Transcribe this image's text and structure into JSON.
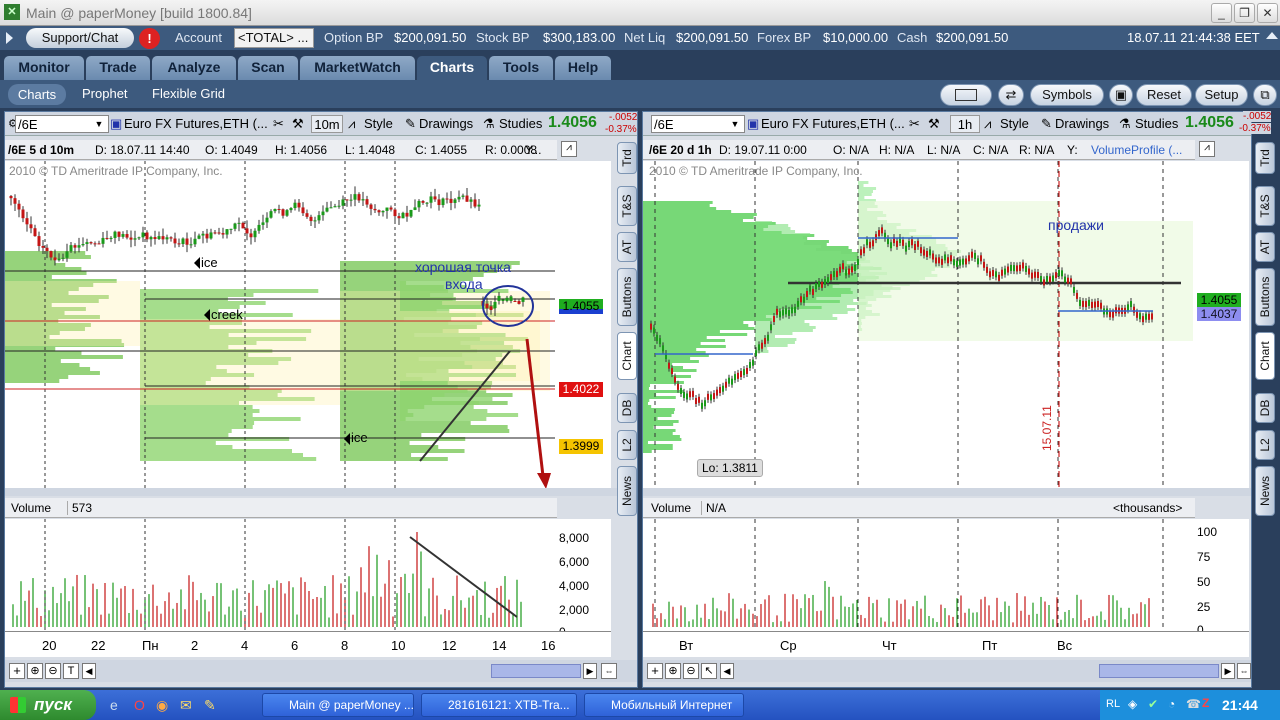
{
  "window": {
    "title": "Main @ paperMoney [build 1800.84]"
  },
  "account": {
    "support": "Support/Chat",
    "account_label": "Account",
    "account_value": "<TOTAL> ...",
    "option_bp_label": "Option BP",
    "option_bp": "$200,091.50",
    "stock_bp_label": "Stock BP",
    "stock_bp": "$300,183.00",
    "net_liq_label": "Net Liq",
    "net_liq": "$200,091.50",
    "forex_bp_label": "Forex BP",
    "forex_bp": "$10,000.00",
    "cash_label": "Cash",
    "cash": "$200,091.50",
    "datetime": "18.07.11 21:44:38 EET"
  },
  "main_tabs": [
    "Monitor",
    "Trade",
    "Analyze",
    "Scan",
    "MarketWatch",
    "Charts",
    "Tools",
    "Help"
  ],
  "sub_tabs": [
    "Charts",
    "Prophet",
    "Flexible Grid"
  ],
  "right_buttons": {
    "symbols": "Symbols",
    "reset": "Reset",
    "setup": "Setup"
  },
  "left_chart": {
    "symbol": "/6E",
    "desc": "Euro FX Futures,ETH (...",
    "interval": "10m",
    "style": "Style",
    "drawings": "Drawings",
    "studies": "Studies",
    "price": "1.4056",
    "chg": "-.0052",
    "chg_pct": "-0.37%",
    "info": {
      "name": "/6E 5 d 10m",
      "d": "D: 18.07.11 14:40",
      "o": "O: 1.4049",
      "h": "H: 1.4056",
      "l": "L: 1.4048",
      "c": "C: 1.4055",
      "r": "R: 0.0008",
      "y": "Y..."
    },
    "copyright": "2010 © TD Ameritrade IP Company, Inc.",
    "annotations": {
      "ice1": "ice",
      "creek": "creek",
      "ice2": "ice",
      "entry1": "хорошая точка",
      "entry2": "входа"
    },
    "price_tags": {
      "p1": "1.4055",
      "p2": "1.4022",
      "p3": "1.3999"
    },
    "volume_label": "Volume",
    "volume_value": "573",
    "vol_ticks": [
      "8,000",
      "6,000",
      "4,000",
      "2,000",
      "0"
    ],
    "x_ticks": [
      "20",
      "22",
      "Пн",
      "2",
      "4",
      "6",
      "8",
      "10",
      "12",
      "14",
      "16"
    ]
  },
  "right_chart": {
    "symbol": "/6E",
    "desc": "Euro FX Futures,ETH (...",
    "interval": "1h",
    "style": "Style",
    "drawings": "Drawings",
    "studies": "Studies",
    "price": "1.4056",
    "chg": "-.0052",
    "chg_pct": "-0.37%",
    "info": {
      "name": "/6E 20 d 1h",
      "d": "D: 19.07.11 0:00",
      "o": "O: N/A",
      "h": "H: N/A",
      "l": "L: N/A",
      "c": "C: N/A",
      "r": "R: N/A",
      "y": "Y:",
      "vp": "VolumeProfile (..."
    },
    "copyright": "2010 © TD Ameritrade IP Company, Inc.",
    "annotations": {
      "sell": "продажи",
      "lo": "Lo: 1.3811",
      "date": "15.07.11"
    },
    "price_tags": {
      "p1": "1.4055",
      "p2": "1.4037"
    },
    "volume_label": "Volume",
    "volume_value": "N/A",
    "thousands": "<thousands>",
    "vol_ticks": [
      "100",
      "75",
      "50",
      "25",
      "0"
    ],
    "x_ticks": [
      "Вт",
      "Ср",
      "Чт",
      "Пт",
      "Вс"
    ]
  },
  "side_tabs": [
    "Trd",
    "T&S",
    "AT",
    "Buttons",
    "Chart",
    "DB",
    "L2",
    "News"
  ],
  "taskbar": {
    "start": "пуск",
    "t1": "Main @ paperMoney ...",
    "t2": "281616121: XTB-Tra...",
    "t3": "Мобильный Интернет",
    "lang": "RL",
    "clock": "21:44"
  }
}
